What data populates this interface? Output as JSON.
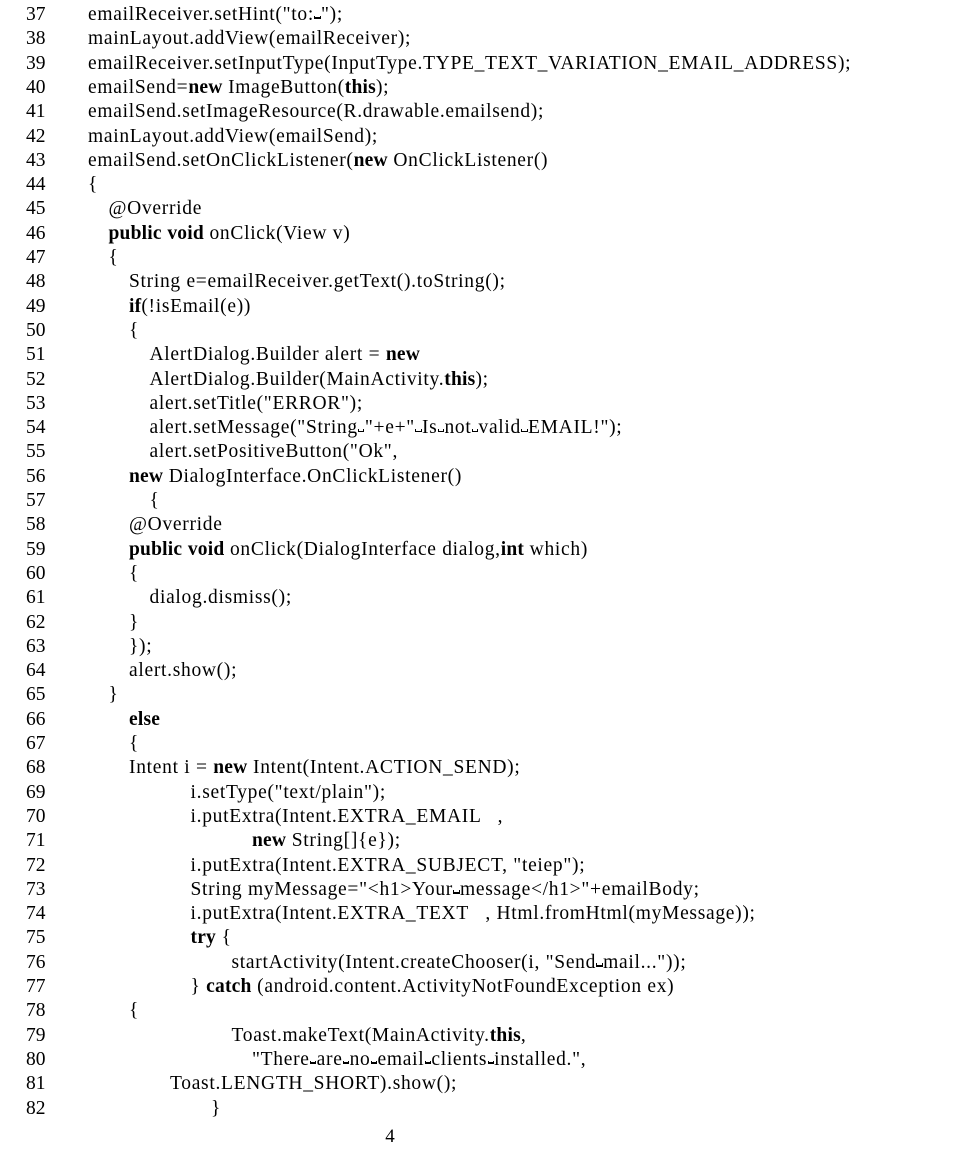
{
  "document": {
    "page_number": "4",
    "type": "code-listing",
    "language": "Java"
  },
  "listing": {
    "first_line_number": 37,
    "last_line_number": 82,
    "lines": [
      {
        "n": "37",
        "indent": 0,
        "text": "emailReceiver.setHint(\"to:␣\");"
      },
      {
        "n": "38",
        "indent": 0,
        "text": "mainLayout.addView(emailReceiver);"
      },
      {
        "n": "39",
        "indent": 0,
        "text": "emailReceiver.setInputType(InputType.TYPE_TEXT_VARIATION_EMAIL_ADDRESS);"
      },
      {
        "n": "40",
        "indent": 0,
        "text": "emailSend=new ImageButton(this);"
      },
      {
        "n": "41",
        "indent": 0,
        "text": "emailSend.setImageResource(R.drawable.emailsend);"
      },
      {
        "n": "42",
        "indent": 0,
        "text": "mainLayout.addView(emailSend);"
      },
      {
        "n": "43",
        "indent": 0,
        "text": "emailSend.setOnClickListener(new OnClickListener()"
      },
      {
        "n": "44",
        "indent": 0,
        "text": "{"
      },
      {
        "n": "45",
        "indent": 1,
        "text": "@Override"
      },
      {
        "n": "46",
        "indent": 1,
        "text": "public void onClick(View v)"
      },
      {
        "n": "47",
        "indent": 1,
        "text": "{"
      },
      {
        "n": "48",
        "indent": 2,
        "text": "String e=emailReceiver.getText().toString();"
      },
      {
        "n": "49",
        "indent": 2,
        "text": "if(!isEmail(e))"
      },
      {
        "n": "50",
        "indent": 2,
        "text": "{"
      },
      {
        "n": "51",
        "indent": 3,
        "text": "AlertDialog.Builder alert = new"
      },
      {
        "n": "52",
        "indent": 3,
        "text": "AlertDialog.Builder(MainActivity.this);"
      },
      {
        "n": "53",
        "indent": 3,
        "text": "alert.setTitle(\"ERROR\");"
      },
      {
        "n": "54",
        "indent": 3,
        "text": "alert.setMessage(\"String␣\"+e+\"␣Is␣not␣valid␣EMAIL!\");"
      },
      {
        "n": "55",
        "indent": 3,
        "text": "alert.setPositiveButton(\"Ok\","
      },
      {
        "n": "56",
        "indent": 2,
        "text": "new DialogInterface.OnClickListener()"
      },
      {
        "n": "57",
        "indent": 3,
        "text": "{"
      },
      {
        "n": "58",
        "indent": 2,
        "text": "@Override"
      },
      {
        "n": "59",
        "indent": 2,
        "text": "public void onClick(DialogInterface dialog,int which)"
      },
      {
        "n": "60",
        "indent": 2,
        "text": "{"
      },
      {
        "n": "61",
        "indent": 3,
        "text": "dialog.dismiss();"
      },
      {
        "n": "62",
        "indent": 2,
        "text": "}"
      },
      {
        "n": "63",
        "indent": 2,
        "text": "});"
      },
      {
        "n": "64",
        "indent": 2,
        "text": "alert.show();"
      },
      {
        "n": "65",
        "indent": 1,
        "text": "}"
      },
      {
        "n": "66",
        "indent": 2,
        "text": "else"
      },
      {
        "n": "67",
        "indent": 2,
        "text": "{"
      },
      {
        "n": "68",
        "indent": 2,
        "text": "Intent i = new Intent(Intent.ACTION_SEND);"
      },
      {
        "n": "69",
        "indent": 5,
        "text": "i.setType(\"text/plain\");"
      },
      {
        "n": "70",
        "indent": 5,
        "text": "i.putExtra(Intent.EXTRA_EMAIL   ,"
      },
      {
        "n": "71",
        "indent": 8,
        "text": "new String[]{e});"
      },
      {
        "n": "72",
        "indent": 5,
        "text": "i.putExtra(Intent.EXTRA_SUBJECT, \"teiep\");"
      },
      {
        "n": "73",
        "indent": 5,
        "text": "String myMessage=\"<h1>Your␣message</h1>\"+emailBody;"
      },
      {
        "n": "74",
        "indent": 5,
        "text": "i.putExtra(Intent.EXTRA_TEXT   , Html.fromHtml(myMessage));"
      },
      {
        "n": "75",
        "indent": 5,
        "text": "try {"
      },
      {
        "n": "76",
        "indent": 7,
        "text": "startActivity(Intent.createChooser(i, \"Send␣mail...\"));"
      },
      {
        "n": "77",
        "indent": 5,
        "text": "} catch (android.content.ActivityNotFoundException ex)"
      },
      {
        "n": "78",
        "indent": 2,
        "text": "{"
      },
      {
        "n": "79",
        "indent": 7,
        "text": "Toast.makeText(MainActivity.this,"
      },
      {
        "n": "80",
        "indent": 8,
        "text": "\"There␣are␣no␣email␣clients␣installed.\","
      },
      {
        "n": "81",
        "indent": 4,
        "text": "Toast.LENGTH_SHORT).show();"
      },
      {
        "n": "82",
        "indent": 6,
        "text": "}"
      }
    ]
  }
}
